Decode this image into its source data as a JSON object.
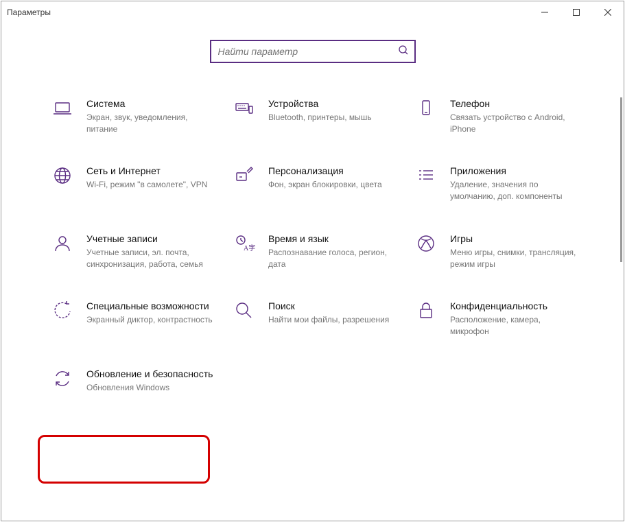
{
  "window": {
    "title": "Параметры"
  },
  "search": {
    "placeholder": "Найти параметр"
  },
  "tiles": {
    "system": {
      "title": "Система",
      "desc": "Экран, звук, уведомления, питание"
    },
    "devices": {
      "title": "Устройства",
      "desc": "Bluetooth, принтеры, мышь"
    },
    "phone": {
      "title": "Телефон",
      "desc": "Связать устройство с Android, iPhone"
    },
    "network": {
      "title": "Сеть и Интернет",
      "desc": "Wi-Fi, режим \"в самолете\", VPN"
    },
    "personalization": {
      "title": "Персонализация",
      "desc": "Фон, экран блокировки, цвета"
    },
    "apps": {
      "title": "Приложения",
      "desc": "Удаление, значения по умолчанию, доп. компоненты"
    },
    "accounts": {
      "title": "Учетные записи",
      "desc": "Учетные записи, эл. почта, синхронизация, работа, семья"
    },
    "time": {
      "title": "Время и язык",
      "desc": "Распознавание голоса, регион, дата"
    },
    "gaming": {
      "title": "Игры",
      "desc": "Меню игры, снимки, трансляция, режим игры"
    },
    "ease": {
      "title": "Специальные возможности",
      "desc": "Экранный диктор, контрастность"
    },
    "searchTile": {
      "title": "Поиск",
      "desc": "Найти мои файлы, разрешения"
    },
    "privacy": {
      "title": "Конфиденциальность",
      "desc": "Расположение, камера, микрофон"
    },
    "update": {
      "title": "Обновление и безопасность",
      "desc": "Обновления Windows"
    }
  }
}
